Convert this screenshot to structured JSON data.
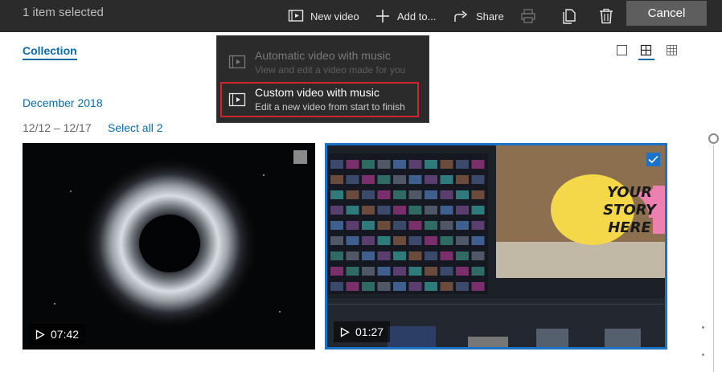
{
  "topbar": {
    "selected_count": "1 item selected",
    "new_video": "New video",
    "add_to": "Add to...",
    "share": "Share",
    "cancel": "Cancel"
  },
  "nav": {
    "collection": "Collection"
  },
  "gallery": {
    "month": "December 2018",
    "range": "12/12 – 12/17",
    "select_all": "Select all 2",
    "items": [
      {
        "duration": "07:42",
        "selected": false
      },
      {
        "duration": "01:27",
        "selected": true
      }
    ]
  },
  "menu": {
    "items": [
      {
        "title": "Automatic video with music",
        "subtitle": "View and edit a video made for you",
        "enabled": false
      },
      {
        "title": "Custom video with music",
        "subtitle": "Edit a new video from start to finish",
        "enabled": true
      }
    ]
  },
  "thumbnail2_overlay": [
    "YOUR",
    "STORY",
    "HERE"
  ],
  "colors": {
    "accent": "#0b6aa8",
    "selection": "#1a73c9",
    "highlight": "#d0272d",
    "topbar": "#2b2b2b"
  }
}
